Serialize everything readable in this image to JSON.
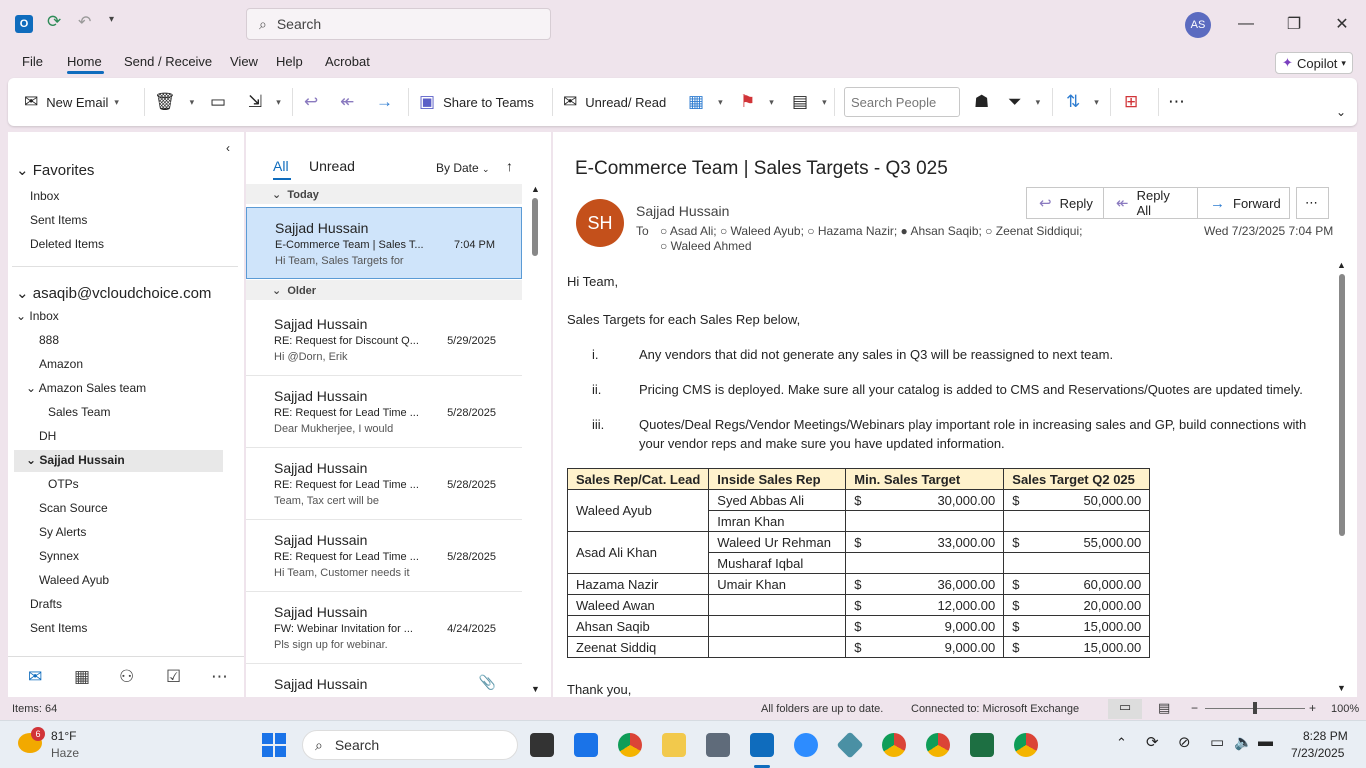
{
  "search": {
    "placeholder": "Search"
  },
  "user_initials": "AS",
  "menu": [
    "File",
    "Home",
    "Send / Receive",
    "View",
    "Help",
    "Acrobat"
  ],
  "copilot": "Copilot",
  "ribbon": {
    "new_email": "New Email",
    "share_teams": "Share to Teams",
    "unread_read": "Unread/ Read",
    "search_people": "Search People"
  },
  "folders": {
    "favorites": "Favorites",
    "fav_items": [
      "Inbox",
      "Sent Items",
      "Deleted Items"
    ],
    "account": "asaqib@vcloudchoice.com",
    "inbox": "Inbox",
    "sub": [
      "888",
      "Amazon",
      "Amazon Sales team",
      "Sales Team",
      "DH",
      "Sajjad Hussain",
      "OTPs",
      "Scan Source",
      "Sy Alerts",
      "Synnex",
      "Waleed Ayub"
    ],
    "after": [
      "Drafts",
      "Sent Items",
      "Deleted Items"
    ]
  },
  "list": {
    "tab_all": "All",
    "tab_unread": "Unread",
    "sort": "By Date",
    "group_today": "Today",
    "group_older": "Older",
    "messages": [
      {
        "from": "Sajjad Hussain",
        "subject": "E-Commerce Team | Sales T...",
        "preview": "Hi Team,  Sales Targets for",
        "date": "7:04 PM"
      },
      {
        "from": "Sajjad Hussain",
        "subject": "RE: Request for Discount Q...",
        "preview": "Hi @Dorn, Erik",
        "date": "5/29/2025"
      },
      {
        "from": "Sajjad Hussain",
        "subject": "RE: Request for Lead Time ...",
        "preview": "Dear Mukherjee,    I would",
        "date": "5/28/2025"
      },
      {
        "from": "Sajjad Hussain",
        "subject": "RE: Request for Lead Time ...",
        "preview": "Team, Tax cert will be",
        "date": "5/28/2025"
      },
      {
        "from": "Sajjad Hussain",
        "subject": "RE: Request for Lead Time ...",
        "preview": "Hi Team,  Customer needs it",
        "date": "5/28/2025"
      },
      {
        "from": "Sajjad Hussain",
        "subject": "FW: Webinar Invitation for ...",
        "preview": "Pls sign up for webinar.",
        "date": "4/24/2025"
      },
      {
        "from": "Sajjad Hussain",
        "subject": "",
        "preview": "",
        "date": ""
      }
    ]
  },
  "email": {
    "subject": "E-Commerce Team | Sales Targets - Q3 025",
    "initials": "SH",
    "sender": "Sajjad Hussain",
    "to_label": "To",
    "recipients_line1": "Asad Ali;  ○ Waleed Ayub;  ○ Hazama Nazir;  ● Ahsan Saqib;  ○ Zeenat Siddiqui;",
    "recipients_line2": "Waleed Ahmed",
    "datetime": "Wed 7/23/2025 7:04 PM",
    "reply": "Reply",
    "reply_all": "Reply All",
    "forward": "Forward",
    "greeting": "Hi Team,",
    "intro": "Sales Targets for each Sales Rep below,",
    "points": [
      {
        "num": "i.",
        "text": "Any vendors that did not generate any sales in Q3 will be reassigned to next team."
      },
      {
        "num": "ii.",
        "text": "Pricing CMS is deployed. Make sure all your catalog is added to CMS and Reservations/Quotes are updated timely."
      },
      {
        "num": "iii.",
        "text": "Quotes/Deal Regs/Vendor Meetings/Webinars play important role in increasing sales and GP, build connections with"
      },
      {
        "num": "",
        "text": "your vendor reps and make sure you have updated information."
      }
    ],
    "table_headers": [
      "Sales Rep/Cat. Lead",
      "Inside Sales Rep",
      "Min. Sales Target",
      "Sales Target Q2 025"
    ],
    "rows": [
      [
        "Waleed Ayub",
        "Syed Abbas Ali",
        "30,000.00",
        "50,000.00"
      ],
      [
        "",
        "Imran Khan",
        "",
        ""
      ],
      [
        "Asad Ali Khan",
        "Waleed Ur Rehman",
        "33,000.00",
        "55,000.00"
      ],
      [
        "",
        "Musharaf Iqbal",
        "",
        ""
      ],
      [
        "Hazama Nazir",
        "Umair Khan",
        "36,000.00",
        "60,000.00"
      ],
      [
        "Waleed Awan",
        "",
        "12,000.00",
        "20,000.00"
      ],
      [
        "Ahsan Saqib",
        "",
        "9,000.00",
        "15,000.00"
      ],
      [
        "Zeenat Siddiq",
        "",
        "9,000.00",
        "15,000.00"
      ]
    ],
    "closing": "Thank you,"
  },
  "status": {
    "items": "Items: 64",
    "sync": "All folders are up to date.",
    "connected": "Connected to: Microsoft Exchange",
    "zoom": "100%"
  },
  "taskbar": {
    "weather_temp": "81°F",
    "weather_desc": "Haze",
    "weather_badge": "6",
    "search": "Search",
    "time": "8:28 PM",
    "date": "7/23/2025"
  }
}
